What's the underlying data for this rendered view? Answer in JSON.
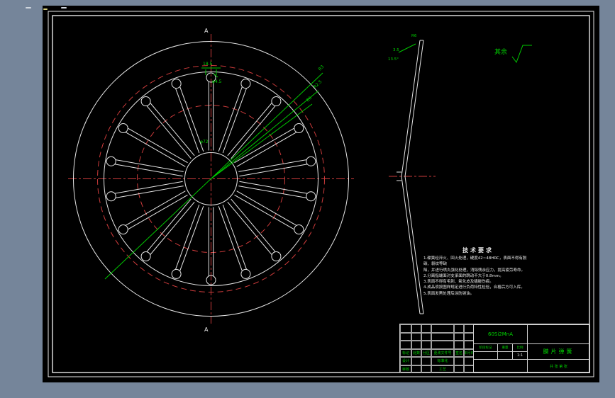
{
  "drawing": {
    "surface_note": "其余",
    "section_label_top": "A",
    "section_label_bottom": "A"
  },
  "front_view": {
    "spoke_count": 18,
    "dim_top_width": "18.5",
    "dim_top_hole": "φ4.5",
    "dim_hub": "φ72",
    "leader_labels": [
      "R3",
      "R2.5",
      "R6"
    ]
  },
  "side_view": {
    "dim_thickness": "3.5",
    "dim_angle": "13.5°",
    "dim_tip": "R6"
  },
  "tech_requirements": {
    "title": "技术要求",
    "lines": [
      "1.碟簧经淬火、回火处理，硬度42~48HRC，表面不得有脱碳、裂纹等缺",
      "  陷，并进行喷丸强化处理，消除残余应力，提高疲劳寿命。",
      "2.分离指端面对支承面的跳动不大于0.8mm。",
      "3.表面不得有毛刺、氧化皮及磕碰伤痕。",
      "4.成品须按图样规定进行负荷特性检验，合格后方可入库。",
      "5.表面发黑处理后涂防锈油。"
    ]
  },
  "title_block": {
    "material": "60Si2MnA",
    "drawing_title": "膜片弹簧",
    "rev_header": [
      "标记",
      "处数",
      "分区",
      "更改文件号",
      "签名",
      "年月日"
    ],
    "sign_rows": [
      [
        "设计",
        "标准化"
      ],
      [
        "审核",
        "工艺"
      ]
    ],
    "stage_header": [
      "阶段标记",
      "重量",
      "比例"
    ],
    "scale_value": "1:1",
    "sheet_note": "共 张  第 张"
  }
}
